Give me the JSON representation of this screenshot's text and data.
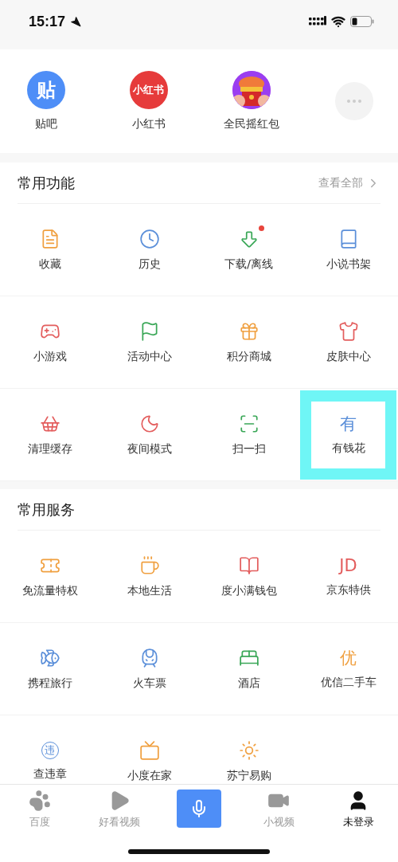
{
  "status_bar": {
    "time": "15:17"
  },
  "apps": [
    {
      "kind": "logo",
      "label": "贴吧",
      "logo_text": "贴"
    },
    {
      "kind": "logo_red",
      "label": "小红书",
      "logo_text": "小红书"
    },
    {
      "kind": "picture",
      "label": "全民摇红包"
    },
    {
      "kind": "more"
    }
  ],
  "common_functions": {
    "title": "常用功能",
    "more": "查看全部",
    "items": [
      {
        "label": "收藏",
        "dot": false,
        "highlighted": false
      },
      {
        "label": "历史",
        "dot": false,
        "highlighted": false
      },
      {
        "label": "下载/离线",
        "dot": true,
        "highlighted": false
      },
      {
        "label": "小说书架",
        "dot": false,
        "highlighted": false
      },
      {
        "label": "小游戏",
        "dot": false,
        "highlighted": false
      },
      {
        "label": "活动中心",
        "dot": false,
        "highlighted": false
      },
      {
        "label": "积分商城",
        "dot": false,
        "highlighted": false
      },
      {
        "label": "皮肤中心",
        "dot": false,
        "highlighted": false
      },
      {
        "label": "清理缓存",
        "dot": false,
        "highlighted": false
      },
      {
        "label": "夜间模式",
        "dot": false,
        "highlighted": false
      },
      {
        "label": "扫一扫",
        "dot": false,
        "highlighted": false
      },
      {
        "label": "有钱花",
        "icon_text": "有",
        "dot": false,
        "highlighted": true
      }
    ]
  },
  "common_services": {
    "title": "常用服务",
    "items": [
      {
        "label": "免流量特权"
      },
      {
        "label": "本地生活"
      },
      {
        "label": "度小满钱包"
      },
      {
        "label": "京东特供",
        "icon_text": "JD"
      },
      {
        "label": "携程旅行"
      },
      {
        "label": "火车票"
      },
      {
        "label": "酒店"
      },
      {
        "label": "优信二手车",
        "icon_text": "优"
      },
      {
        "label": "查违章",
        "icon_text": "违"
      },
      {
        "label": "小度在家"
      },
      {
        "label": "苏宁易购"
      }
    ]
  },
  "tab_bar": [
    {
      "label": "百度",
      "selected": false
    },
    {
      "label": "好看视频",
      "selected": false
    },
    {
      "kind": "voice"
    },
    {
      "label": "小视频",
      "selected": false
    },
    {
      "label": "未登录",
      "selected": true
    }
  ]
}
